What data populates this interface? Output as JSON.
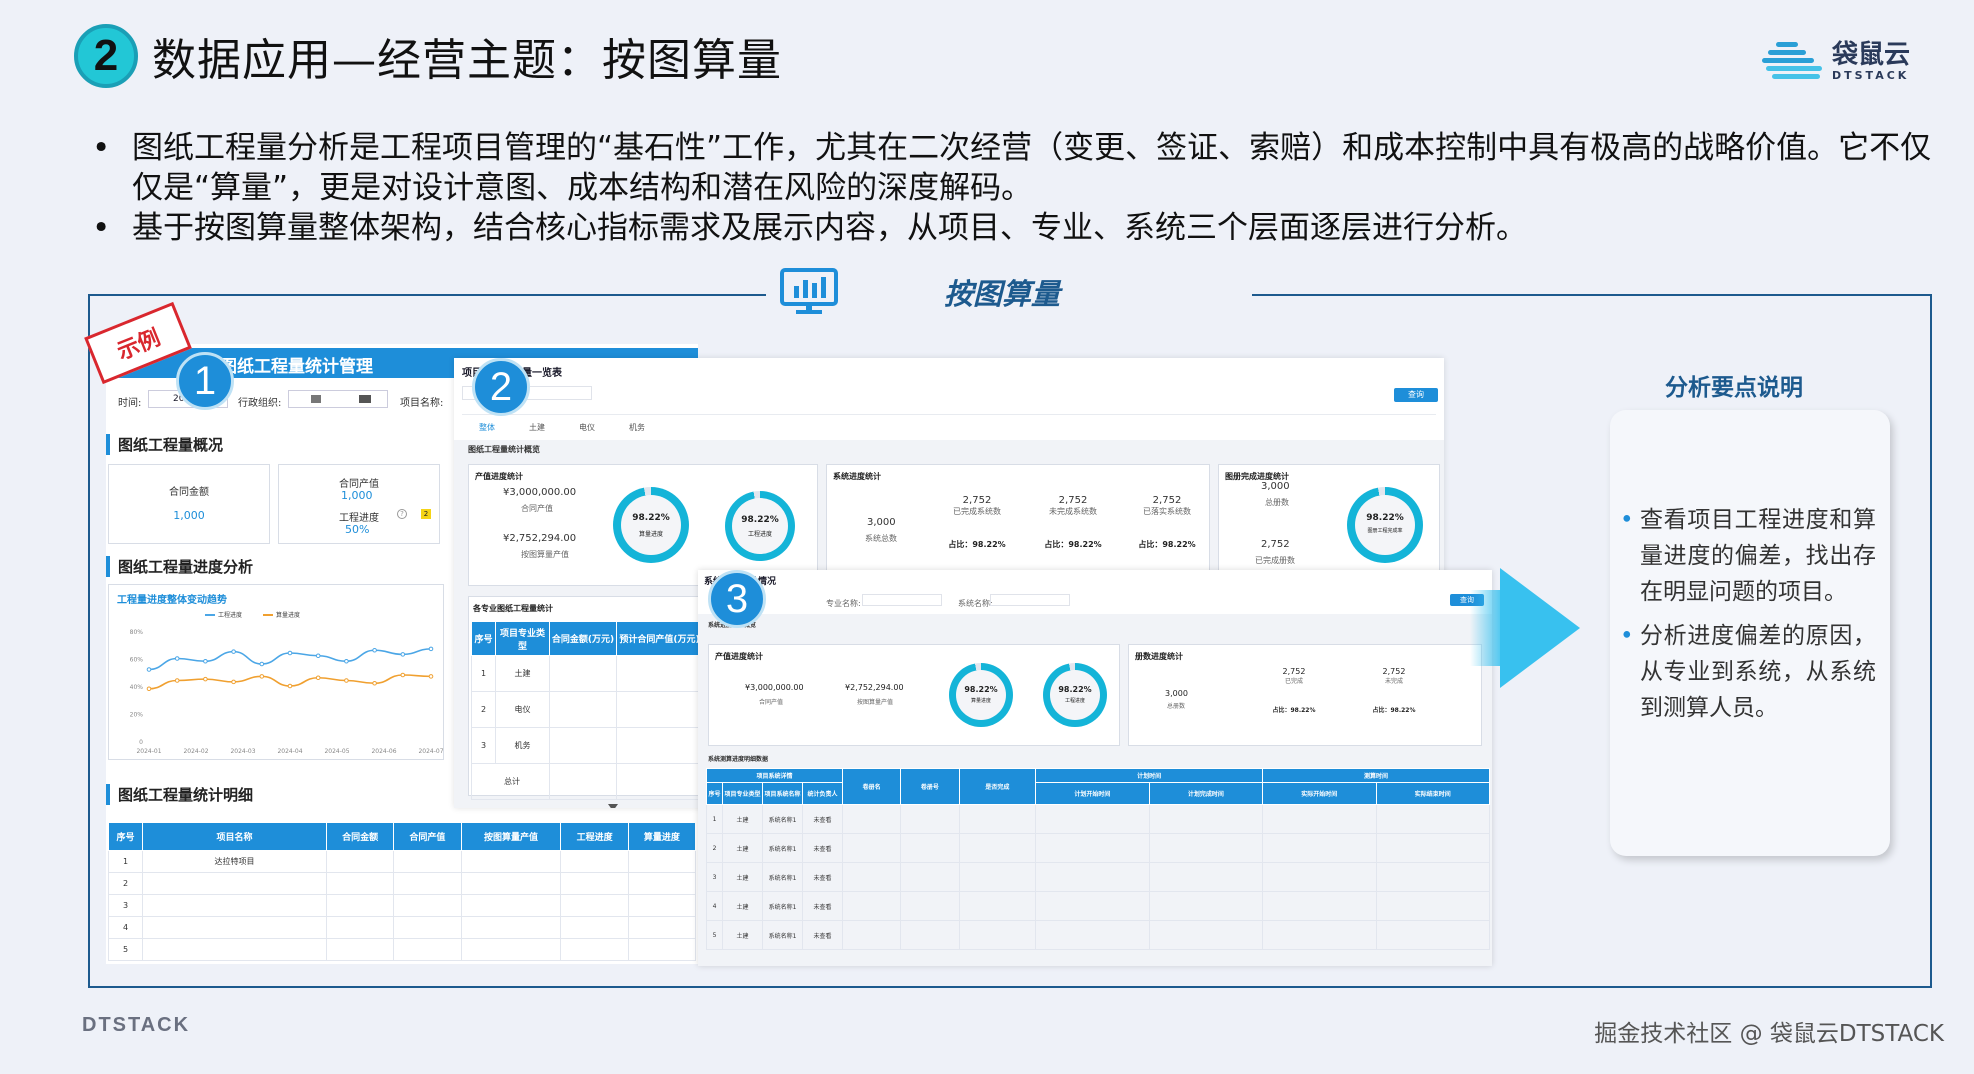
{
  "header": {
    "step_number": "2",
    "title": "数据应用—经营主题：按图算量",
    "logo_cn": "袋鼠云",
    "logo_en": "DTSTACK"
  },
  "bullets": [
    "图纸工程量分析是工程项目管理的“基石性”工作，尤其在二次经营（变更、签证、索赔）和成本控制中具有极高的战略价值。它不仅仅是“算量”，更是对设计意图、成本结构和潜在风险的深度解码。",
    "基于按图算量整体架构，结合核心指标需求及展示内容，从项目、专业、系统三个层面逐层进行分析。"
  ],
  "frame_title": "按图算量",
  "stamp": "示例",
  "badges": [
    "1",
    "2",
    "3"
  ],
  "panel1": {
    "title": "项目图纸工程量统计管理",
    "filters": {
      "time_label": "时间:",
      "time_value": "20",
      "org_label": "行政组织:",
      "project_label": "项目名称:"
    },
    "overview_title": "图纸工程量概况",
    "card1": {
      "label": "合同金额",
      "value": "1,000"
    },
    "card2": {
      "label1": "合同产值",
      "value1": "1,000",
      "label2": "工程进度",
      "value2": "50%"
    },
    "progress_title": "图纸工程量进度分析",
    "chart_title": "工程量进度整体变动趋势",
    "detail_title": "图纸工程量统计明细",
    "table_headers": [
      "序号",
      "项目名称",
      "合同金额",
      "合同产值",
      "按图算量产值",
      "工程进度",
      "算量进度"
    ],
    "table_rows": [
      [
        "1",
        "达拉特项目"
      ],
      [
        "2",
        ""
      ],
      [
        "3",
        ""
      ],
      [
        "4",
        ""
      ],
      [
        "5",
        ""
      ]
    ]
  },
  "chart_data": {
    "type": "line",
    "title": "工程量进度整体变动趋势",
    "x": [
      "2024-01",
      "2024-02",
      "2024-03",
      "2024-04",
      "2024-05",
      "2024-06",
      "2024-07"
    ],
    "ylim": [
      0,
      80
    ],
    "yticks": [
      "0",
      "20%",
      "40%",
      "60%",
      "80%"
    ],
    "series": [
      {
        "name": "工程进度",
        "values": [
          52,
          60,
          58,
          65,
          56,
          64,
          62,
          58,
          66,
          63,
          67
        ],
        "color": "#4ba6e6"
      },
      {
        "name": "算量进度",
        "values": [
          38,
          44,
          45,
          43,
          47,
          40,
          46,
          44,
          42,
          48,
          47
        ],
        "color": "#f0a030"
      }
    ]
  },
  "panel2": {
    "title": "项目图纸工程量一览表",
    "query_button": "查询",
    "tabs": [
      "整体",
      "土建",
      "电仪",
      "机务"
    ],
    "section_title": "图纸工程量统计概览",
    "output_card": {
      "title": "产值进度统计",
      "v1": "¥3,000,000.00",
      "l1": "合同产值",
      "v2": "¥2,752,294.00",
      "l2": "按图算量产值",
      "g1": "98.22%",
      "g1l": "算量进度",
      "g2": "98.22%",
      "g2l": "工程进度"
    },
    "system_card": {
      "title": "系统进度统计",
      "total": "3,000",
      "total_label": "系统总数",
      "cols": [
        {
          "v": "2,752",
          "l": "已完成系统数",
          "r": "占比：98.22%"
        },
        {
          "v": "2,752",
          "l": "未完成系统数",
          "r": "占比：98.22%"
        },
        {
          "v": "2,752",
          "l": "已落实系统数",
          "r": "占比：98.22%"
        }
      ]
    },
    "drawing_card": {
      "title": "图册完成进度统计",
      "v1": "3,000",
      "l1": "总册数",
      "v2": "2,752",
      "l2": "已完成册数",
      "g": "98.22%",
      "gl": "图册工程完成率"
    },
    "table_title": "各专业图纸工程量统计",
    "table_headers": [
      "序号",
      "项目专业类型",
      "合同金额(万元)",
      "预计合同产值(万元)"
    ],
    "rows": [
      [
        "1",
        "土建"
      ],
      [
        "2",
        "电仪"
      ],
      [
        "3",
        "机务"
      ]
    ],
    "total_label": "总计"
  },
  "panel3": {
    "title": "系统进度统计情况",
    "query_button": "查询",
    "filter_major": "专业名称:",
    "filter_system": "系统名称:",
    "section_title": "系统进度汇总概览",
    "output_card": {
      "title": "产值进度统计",
      "v1": "¥3,000,000.00",
      "l1": "合同产值",
      "v2": "¥2,752,294.00",
      "l2": "按图算量产值",
      "g1": "98.22%",
      "g1l": "算量进度",
      "g2": "98.22%",
      "g2l": "工程进度"
    },
    "drawing_card": {
      "title": "册数进度统计",
      "total": "3,000",
      "total_label": "总册数",
      "cols": [
        {
          "v": "2,752",
          "l": "已完成",
          "r": "占比：98.22%"
        },
        {
          "v": "2,752",
          "l": "未完成",
          "r": "占比：98.22%"
        }
      ]
    },
    "table_title": "系统测算进度明细数据",
    "group_headers": [
      "项目系统详情",
      "计划时间",
      "测算时间"
    ],
    "headers": [
      "序号",
      "项目专业类型",
      "项目系统名称",
      "统计负责人",
      "卷册名",
      "卷册号",
      "是否完成",
      "计划开始时间",
      "计划完成时间",
      "实际开始时间",
      "实际结束时间"
    ],
    "rows": [
      [
        "1",
        "土建",
        "系统名称1",
        "未查看"
      ],
      [
        "2",
        "土建",
        "系统名称1",
        "未查看"
      ],
      [
        "3",
        "土建",
        "系统名称1",
        "未查看"
      ],
      [
        "4",
        "土建",
        "系统名称1",
        "未查看"
      ],
      [
        "5",
        "土建",
        "系统名称1",
        "未查看"
      ]
    ]
  },
  "explanation": {
    "title": "分析要点说明",
    "items": [
      "查看项目工程进度和算量进度的偏差，找出存在明显问题的项目。",
      "分析进度偏差的原因，从专业到系统，从系统到测算人员。"
    ]
  },
  "footer": {
    "left": "DTSTACK",
    "right": "掘金技术社区 @ 袋鼠云DTSTACK"
  },
  "colors": {
    "accent": "#1e8ed9",
    "frame": "#1d5a8e",
    "stamp": "#d9272e",
    "badge_title": "#22c7d6"
  }
}
